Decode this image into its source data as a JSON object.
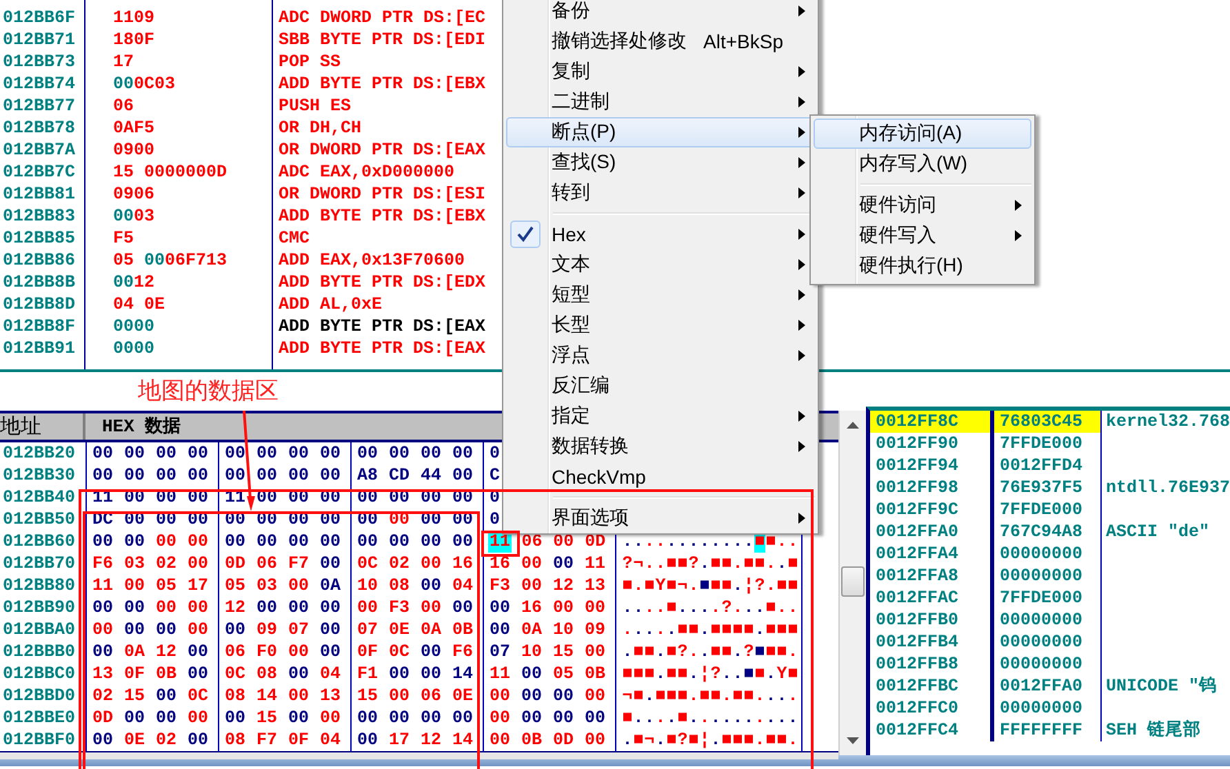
{
  "disassembly": {
    "rows": [
      {
        "address": "012BB6F",
        "hex": [
          {
            "text": "1109",
            "changed": true
          }
        ],
        "command": "ADC DWORD PTR DS:[EC",
        "changed": true
      },
      {
        "address": "012BB71",
        "hex": [
          {
            "text": "180F",
            "changed": true
          }
        ],
        "command": "SBB BYTE PTR DS:[EDI",
        "changed": true
      },
      {
        "address": "012BB73",
        "hex": [
          {
            "text": "17",
            "changed": true
          }
        ],
        "command": "POP SS",
        "changed": true
      },
      {
        "address": "012BB74",
        "hex": [
          {
            "text": "00",
            "changed": false
          },
          {
            "text": "0C03",
            "changed": true
          }
        ],
        "command": "ADD BYTE PTR DS:[EBX",
        "changed": true
      },
      {
        "address": "012BB77",
        "hex": [
          {
            "text": "06",
            "changed": true
          }
        ],
        "command": "PUSH ES",
        "changed": true
      },
      {
        "address": "012BB78",
        "hex": [
          {
            "text": "0AF5",
            "changed": true
          }
        ],
        "command": "OR DH,CH",
        "changed": true
      },
      {
        "address": "012BB7A",
        "hex": [
          {
            "text": "0900",
            "changed": true
          }
        ],
        "command": "OR DWORD PTR DS:[EAX",
        "changed": true
      },
      {
        "address": "012BB7C",
        "hex": [
          {
            "text": "15 0000000D",
            "changed": true
          }
        ],
        "command": "ADC EAX,0xD000000",
        "changed": true
      },
      {
        "address": "012BB81",
        "hex": [
          {
            "text": "0906",
            "changed": true
          }
        ],
        "command": "OR DWORD PTR DS:[ESI",
        "changed": true
      },
      {
        "address": "012BB83",
        "hex": [
          {
            "text": "00",
            "changed": false
          },
          {
            "text": "03",
            "changed": true
          }
        ],
        "command": "ADD BYTE PTR DS:[EBX",
        "changed": true
      },
      {
        "address": "012BB85",
        "hex": [
          {
            "text": "F5",
            "changed": true
          }
        ],
        "command": "CMC",
        "changed": true
      },
      {
        "address": "012BB86",
        "hex": [
          {
            "text": "05 ",
            "changed": true
          },
          {
            "text": "00",
            "changed": false
          },
          {
            "text": "06F713",
            "changed": true
          }
        ],
        "command": "ADD EAX,0x13F70600",
        "changed": true
      },
      {
        "address": "012BB8B",
        "hex": [
          {
            "text": "00",
            "changed": false
          },
          {
            "text": "12",
            "changed": true
          }
        ],
        "command": "ADD BYTE PTR DS:[EDX",
        "changed": true
      },
      {
        "address": "012BB8D",
        "hex": [
          {
            "text": "04 0E",
            "changed": true
          }
        ],
        "command": "ADD AL,0xE",
        "changed": true
      },
      {
        "address": "012BB8F",
        "hex": [
          {
            "text": "0000",
            "changed": false
          }
        ],
        "command": "ADD BYTE PTR DS:[EAX",
        "changed": false
      },
      {
        "address": "012BB91",
        "hex": [
          {
            "text": "0000",
            "changed": false
          }
        ],
        "command": "ADD BYTE PTR DS:[EAX",
        "changed": true
      }
    ]
  },
  "annotation": {
    "label": "地图的数据区"
  },
  "dump": {
    "columns": [
      "地址",
      "HEX 数据"
    ],
    "rows": [
      {
        "address": "012BB20",
        "bytes": [
          "00",
          "00",
          "00",
          "00",
          "00",
          "00",
          "00",
          "00",
          "00",
          "00",
          "00",
          "00",
          "0"
        ],
        "changed": [
          false,
          false,
          false,
          false,
          false,
          false,
          false,
          false,
          false,
          false,
          false,
          false,
          false
        ],
        "selected": [
          false,
          false,
          false,
          false,
          false,
          false,
          false,
          false,
          false,
          false,
          false,
          false,
          false
        ]
      },
      {
        "address": "012BB30",
        "bytes": [
          "00",
          "00",
          "00",
          "00",
          "00",
          "00",
          "00",
          "00",
          "A8",
          "CD",
          "44",
          "00",
          "C"
        ],
        "changed": [
          false,
          false,
          false,
          false,
          false,
          false,
          false,
          false,
          false,
          false,
          false,
          false,
          false
        ],
        "selected": [
          false,
          false,
          false,
          false,
          false,
          false,
          false,
          false,
          false,
          false,
          false,
          false,
          false
        ]
      },
      {
        "address": "012BB40",
        "bytes": [
          "11",
          "00",
          "00",
          "00",
          "11",
          "00",
          "00",
          "00",
          "00",
          "00",
          "00",
          "00",
          "0"
        ],
        "changed": [
          false,
          false,
          false,
          false,
          false,
          false,
          false,
          false,
          false,
          false,
          false,
          false,
          false
        ],
        "selected": [
          false,
          false,
          false,
          false,
          false,
          false,
          false,
          false,
          false,
          false,
          false,
          false,
          false
        ]
      },
      {
        "address": "012BB50",
        "bytes": [
          "DC",
          "00",
          "00",
          "00",
          "00",
          "00",
          "00",
          "00",
          "00",
          "00",
          "00",
          "00",
          "0"
        ],
        "changed": [
          false,
          false,
          false,
          false,
          false,
          false,
          false,
          false,
          false,
          true,
          false,
          false,
          false
        ],
        "selected": [
          false,
          false,
          false,
          false,
          false,
          false,
          false,
          false,
          false,
          false,
          false,
          false,
          false
        ]
      },
      {
        "address": "012BB60",
        "bytes": [
          "00",
          "00",
          "00",
          "00",
          "00",
          "00",
          "00",
          "00",
          "00",
          "00",
          "00",
          "00",
          "11",
          "06",
          "00",
          "0D"
        ],
        "changed": [
          false,
          false,
          true,
          true,
          false,
          false,
          false,
          false,
          false,
          false,
          false,
          false,
          true,
          true,
          true,
          true
        ],
        "selected": [
          false,
          false,
          false,
          false,
          false,
          false,
          false,
          false,
          false,
          false,
          false,
          false,
          true,
          false,
          false,
          false
        ],
        "ascii": "............■■.."
      },
      {
        "address": "012BB70",
        "bytes": [
          "F6",
          "03",
          "02",
          "00",
          "0D",
          "06",
          "F7",
          "00",
          "0C",
          "02",
          "00",
          "16",
          "16",
          "00",
          "00",
          "11"
        ],
        "changed": [
          true,
          true,
          true,
          true,
          true,
          true,
          true,
          false,
          true,
          true,
          true,
          true,
          true,
          true,
          false,
          true
        ],
        "selected": [
          false,
          false,
          false,
          false,
          false,
          false,
          false,
          false,
          false,
          false,
          false,
          false,
          false,
          false,
          false,
          false
        ],
        "ascii": "?¬..■■?.■■.■■..■"
      },
      {
        "address": "012BB80",
        "bytes": [
          "11",
          "00",
          "05",
          "17",
          "05",
          "03",
          "00",
          "0A",
          "10",
          "08",
          "00",
          "04",
          "F3",
          "00",
          "12",
          "13"
        ],
        "changed": [
          true,
          true,
          true,
          true,
          true,
          true,
          true,
          false,
          true,
          true,
          false,
          true,
          true,
          true,
          true,
          true
        ],
        "selected": [
          false,
          false,
          false,
          false,
          false,
          false,
          false,
          false,
          false,
          false,
          false,
          false,
          false,
          false,
          false,
          false
        ],
        "ascii": "■.■Y■¬.■■■.¦?.■■"
      },
      {
        "address": "012BB90",
        "bytes": [
          "00",
          "00",
          "00",
          "00",
          "12",
          "00",
          "00",
          "00",
          "00",
          "F3",
          "00",
          "00",
          "00",
          "16",
          "00",
          "00"
        ],
        "changed": [
          false,
          false,
          true,
          true,
          true,
          false,
          false,
          false,
          true,
          true,
          true,
          false,
          false,
          true,
          true,
          true
        ],
        "selected": [
          false,
          false,
          false,
          false,
          false,
          false,
          false,
          false,
          false,
          false,
          false,
          false,
          false,
          false,
          false,
          false
        ],
        "ascii": "....■....?...■.."
      },
      {
        "address": "012BBA0",
        "bytes": [
          "00",
          "00",
          "00",
          "00",
          "00",
          "09",
          "07",
          "00",
          "07",
          "0E",
          "0A",
          "0B",
          "00",
          "0A",
          "10",
          "09"
        ],
        "changed": [
          true,
          false,
          false,
          true,
          false,
          true,
          true,
          false,
          true,
          true,
          true,
          true,
          false,
          true,
          true,
          true
        ],
        "selected": [
          false,
          false,
          false,
          false,
          false,
          false,
          false,
          false,
          false,
          false,
          false,
          false,
          false,
          false,
          false,
          false
        ],
        "ascii": ".....■■.■■■■.■■■"
      },
      {
        "address": "012BBB0",
        "bytes": [
          "00",
          "0A",
          "12",
          "00",
          "06",
          "F0",
          "00",
          "00",
          "0F",
          "0C",
          "00",
          "F6",
          "07",
          "10",
          "15",
          "00"
        ],
        "changed": [
          false,
          true,
          true,
          false,
          true,
          true,
          true,
          false,
          true,
          true,
          false,
          true,
          false,
          true,
          true,
          true
        ],
        "selected": [
          false,
          false,
          false,
          false,
          false,
          false,
          false,
          false,
          false,
          false,
          false,
          false,
          false,
          false,
          false,
          false
        ],
        "ascii": ".■■.■?..■■.?■■■."
      },
      {
        "address": "012BBC0",
        "bytes": [
          "13",
          "0F",
          "0B",
          "00",
          "0C",
          "08",
          "00",
          "04",
          "F1",
          "00",
          "00",
          "14",
          "11",
          "00",
          "05",
          "0B"
        ],
        "changed": [
          true,
          true,
          true,
          false,
          true,
          true,
          false,
          true,
          true,
          false,
          false,
          false,
          true,
          false,
          true,
          true
        ],
        "selected": [
          false,
          false,
          false,
          false,
          false,
          false,
          false,
          false,
          false,
          false,
          false,
          false,
          false,
          false,
          false,
          false
        ],
        "ascii": "■■■.■■.¦?..■■.Y■"
      },
      {
        "address": "012BBD0",
        "bytes": [
          "02",
          "15",
          "00",
          "0C",
          "08",
          "14",
          "00",
          "13",
          "15",
          "00",
          "06",
          "0E",
          "00",
          "00",
          "00",
          "00"
        ],
        "changed": [
          true,
          true,
          false,
          true,
          true,
          true,
          true,
          true,
          true,
          true,
          true,
          true,
          true,
          false,
          false,
          true
        ],
        "selected": [
          false,
          false,
          false,
          false,
          false,
          false,
          false,
          false,
          false,
          false,
          false,
          false,
          false,
          false,
          false,
          false
        ],
        "ascii": "¬■.■■■.■■.■■...."
      },
      {
        "address": "012BBE0",
        "bytes": [
          "0D",
          "00",
          "00",
          "00",
          "00",
          "15",
          "00",
          "00",
          "00",
          "00",
          "00",
          "00",
          "00",
          "00",
          "00",
          "00"
        ],
        "changed": [
          true,
          false,
          false,
          true,
          false,
          true,
          false,
          true,
          false,
          false,
          false,
          false,
          true,
          false,
          false,
          false
        ],
        "selected": [
          false,
          false,
          false,
          false,
          false,
          false,
          false,
          false,
          false,
          false,
          false,
          false,
          false,
          false,
          false,
          false
        ],
        "ascii": "■....■.........."
      },
      {
        "address": "012BBF0",
        "bytes": [
          "00",
          "0E",
          "02",
          "00",
          "08",
          "F7",
          "0F",
          "04",
          "00",
          "17",
          "12",
          "14",
          "00",
          "0B",
          "0D",
          "00"
        ],
        "changed": [
          false,
          true,
          true,
          false,
          true,
          true,
          true,
          true,
          false,
          true,
          true,
          true,
          true,
          true,
          true,
          true
        ],
        "selected": [
          false,
          false,
          false,
          false,
          false,
          false,
          false,
          false,
          false,
          false,
          false,
          false,
          false,
          false,
          false,
          false
        ],
        "ascii": ".■¬.■?■¦.■■■.■■."
      }
    ]
  },
  "stack": {
    "rows": [
      {
        "address": "0012FF8C",
        "value": "76803C45",
        "comment": "kernel32.768",
        "selected": true
      },
      {
        "address": "0012FF90",
        "value": "7FFDE000",
        "selected": false
      },
      {
        "address": "0012FF94",
        "value": "0012FFD4",
        "selected": false
      },
      {
        "address": "0012FF98",
        "value": "76E937F5",
        "comment": "ntdll.76E937",
        "selected": false
      },
      {
        "address": "0012FF9C",
        "value": "7FFDE000",
        "selected": false
      },
      {
        "address": "0012FFA0",
        "value": "767C94A8",
        "comment": "ASCII \"de\"",
        "selected": false
      },
      {
        "address": "0012FFA4",
        "value": "00000000",
        "selected": false
      },
      {
        "address": "0012FFA8",
        "value": "00000000",
        "selected": false
      },
      {
        "address": "0012FFAC",
        "value": "7FFDE000",
        "selected": false
      },
      {
        "address": "0012FFB0",
        "value": "00000000",
        "selected": false
      },
      {
        "address": "0012FFB4",
        "value": "00000000",
        "selected": false
      },
      {
        "address": "0012FFB8",
        "value": "00000000",
        "selected": false
      },
      {
        "address": "0012FFBC",
        "value": "0012FFA0",
        "comment": "UNICODE \"钨",
        "selected": false
      },
      {
        "address": "0012FFC0",
        "value": "00000000",
        "selected": false
      },
      {
        "address": "0012FFC4",
        "value": "FFFFFFFF",
        "comment": "SEH 链尾部",
        "selected": false
      }
    ]
  },
  "context_menu": {
    "items": [
      {
        "kind": "item",
        "label": "备份",
        "submenu": true,
        "checked": false,
        "selected": false
      },
      {
        "kind": "item",
        "label": "撤销选择处修改",
        "shortcut": "Alt+BkSp",
        "submenu": false,
        "checked": false,
        "selected": false
      },
      {
        "kind": "item",
        "label": "复制",
        "submenu": true,
        "checked": false,
        "selected": false
      },
      {
        "kind": "item",
        "label": "二进制",
        "submenu": true,
        "checked": false,
        "selected": false
      },
      {
        "kind": "item",
        "label": "断点(P)",
        "submenu": true,
        "checked": false,
        "selected": true
      },
      {
        "kind": "item",
        "label": "查找(S)",
        "submenu": true,
        "checked": false,
        "selected": false
      },
      {
        "kind": "item",
        "label": "转到",
        "submenu": true,
        "checked": false,
        "selected": false
      },
      {
        "kind": "separator"
      },
      {
        "kind": "item",
        "label": "Hex",
        "submenu": true,
        "checked": true,
        "selected": false
      },
      {
        "kind": "item",
        "label": "文本",
        "submenu": true,
        "checked": false,
        "selected": false
      },
      {
        "kind": "item",
        "label": "短型",
        "submenu": true,
        "checked": false,
        "selected": false
      },
      {
        "kind": "item",
        "label": "长型",
        "submenu": true,
        "checked": false,
        "selected": false
      },
      {
        "kind": "item",
        "label": "浮点",
        "submenu": true,
        "checked": false,
        "selected": false
      },
      {
        "kind": "item",
        "label": "反汇编",
        "submenu": false,
        "checked": false,
        "selected": false
      },
      {
        "kind": "item",
        "label": "指定",
        "submenu": true,
        "checked": false,
        "selected": false
      },
      {
        "kind": "item",
        "label": "数据转换",
        "submenu": true,
        "checked": false,
        "selected": false
      },
      {
        "kind": "item",
        "label": "CheckVmp",
        "submenu": false,
        "checked": false,
        "selected": false
      },
      {
        "kind": "separator"
      },
      {
        "kind": "item",
        "label": "界面选项",
        "submenu": true,
        "checked": false,
        "selected": false
      }
    ]
  },
  "submenu": {
    "items": [
      {
        "kind": "item",
        "label": "内存访问(A)",
        "submenu": false,
        "checked": false,
        "selected": true
      },
      {
        "kind": "item",
        "label": "内存写入(W)",
        "submenu": false,
        "checked": false,
        "selected": false
      },
      {
        "kind": "separator"
      },
      {
        "kind": "item",
        "label": "硬件访问",
        "submenu": true,
        "checked": false,
        "selected": false
      },
      {
        "kind": "item",
        "label": "硬件写入",
        "submenu": true,
        "checked": false,
        "selected": false
      },
      {
        "kind": "item",
        "label": "硬件执行(H)",
        "submenu": false,
        "checked": false,
        "selected": false
      }
    ]
  }
}
